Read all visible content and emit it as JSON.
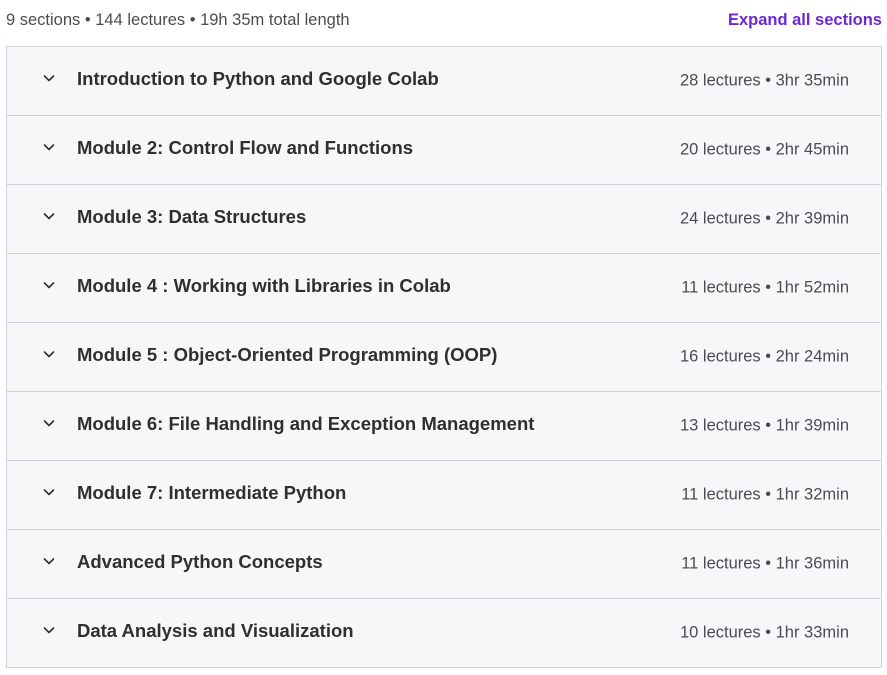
{
  "summary": "9 sections • 144 lectures • 19h 35m total length",
  "expand_label": "Expand all sections",
  "colors": {
    "accent": "#6d28d2",
    "row_background": "#f6f7f9",
    "border": "#d1d2e0"
  },
  "sections": [
    {
      "title": "Introduction to Python and Google Colab",
      "meta": "28 lectures • 3hr 35min"
    },
    {
      "title": "Module 2: Control Flow and Functions",
      "meta": "20 lectures • 2hr 45min"
    },
    {
      "title": "Module 3: Data Structures",
      "meta": "24 lectures • 2hr 39min"
    },
    {
      "title": "Module 4 : Working with Libraries in Colab",
      "meta": "11 lectures • 1hr 52min"
    },
    {
      "title": "Module 5 : Object-Oriented Programming (OOP)",
      "meta": "16 lectures • 2hr 24min"
    },
    {
      "title": "Module 6: File Handling and Exception Management",
      "meta": "13 lectures • 1hr 39min"
    },
    {
      "title": "Module 7: Intermediate Python",
      "meta": "11 lectures • 1hr 32min"
    },
    {
      "title": "Advanced Python Concepts",
      "meta": "11 lectures • 1hr 36min"
    },
    {
      "title": "Data Analysis and Visualization",
      "meta": "10 lectures • 1hr 33min"
    }
  ]
}
